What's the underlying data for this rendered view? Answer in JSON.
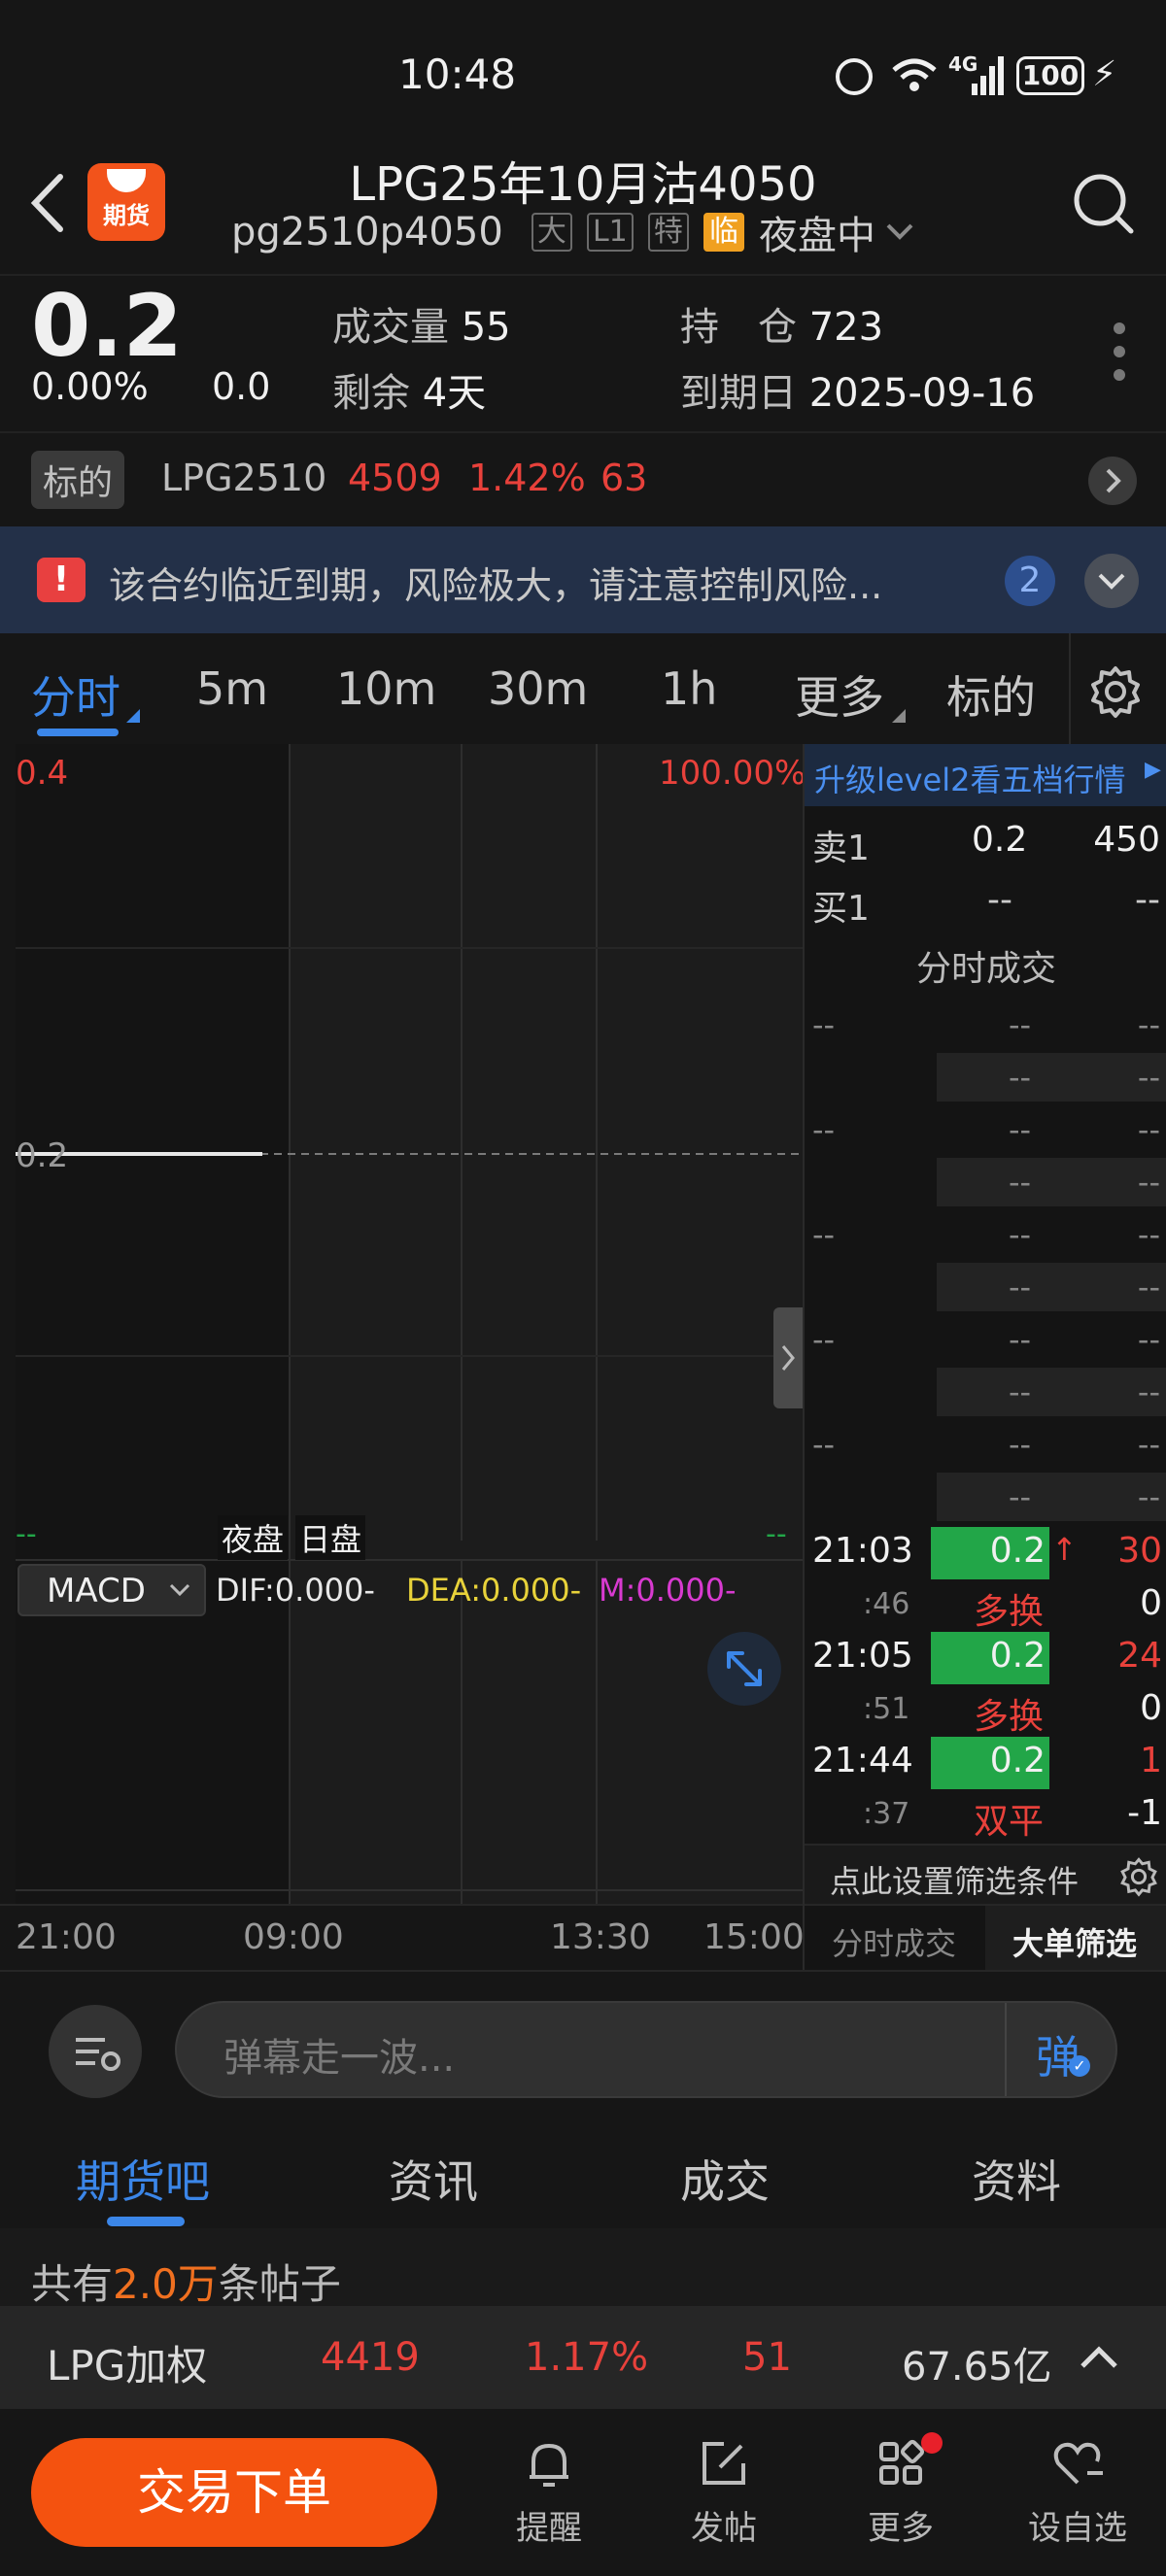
{
  "status_bar": {
    "time": "10:48",
    "network": "4G",
    "battery": "100"
  },
  "header": {
    "title": "LPG25年10月沽4050",
    "code": "pg2510p4050",
    "tags": [
      "大",
      "L1",
      "特"
    ],
    "tag_highlight": "临",
    "session": "夜盘中",
    "logo_text": "期货"
  },
  "quote": {
    "price": "0.2",
    "change_pct": "0.00%",
    "change": "0.0",
    "volume_label": "成交量",
    "volume": "55",
    "remaining_label": "剩余",
    "remaining": "4天",
    "oi_label": "持　仓",
    "oi": "723",
    "expiry_label": "到期日",
    "expiry": "2025-09-16"
  },
  "underlying": {
    "label": "标的",
    "code": "LPG2510",
    "price": "4509",
    "pct": "1.42%",
    "change": "63"
  },
  "warning": {
    "text": "该合约临近到期，风险极大，请注意控制风险...",
    "count": "2"
  },
  "periods": {
    "tabs": [
      "分时",
      "5m",
      "10m",
      "30m",
      "1h",
      "更多",
      "标的"
    ],
    "active": 0
  },
  "chart": {
    "y_top": "0.4",
    "y_top_pct": "100.00%",
    "y_mid": "0.2",
    "y_bottom_left": "--",
    "y_bottom_right": "--",
    "session_labels": [
      "夜盘",
      "日盘"
    ],
    "indicator": "MACD",
    "dif": "DIF:0.000-",
    "dea": "DEA:0.000-",
    "m": "M:0.000-",
    "x_labels": [
      "21:00",
      "09:00",
      "13:30",
      "15:00"
    ],
    "colors": {
      "price_line": "#e8e8e8",
      "dif": "#e8e8e8",
      "dea": "#e8d23a",
      "m": "#d83ad0"
    }
  },
  "orderbook": {
    "upgrade": "升级level2看五档行情",
    "sell_label": "卖1",
    "sell_price": "0.2",
    "sell_vol": "450",
    "buy_label": "买1",
    "buy_price": "--",
    "buy_vol": "--",
    "section_title": "分时成交"
  },
  "trades": [
    {
      "time": "21:03",
      "sec": ":46",
      "price": "0.2",
      "vol": "30",
      "type": "多换",
      "oi": "0",
      "arrow": "↑"
    },
    {
      "time": "21:05",
      "sec": ":51",
      "price": "0.2",
      "vol": "24",
      "type": "多换",
      "oi": "0",
      "arrow": ""
    },
    {
      "time": "21:44",
      "sec": ":37",
      "price": "0.2",
      "vol": "1",
      "type": "双平",
      "oi": "-1",
      "arrow": ""
    }
  ],
  "filter": {
    "text": "点此设置筛选条件",
    "tab1": "分时成交",
    "tab2": "大单筛选"
  },
  "danmu": {
    "placeholder": "弹幕走一波...",
    "send": "弹"
  },
  "bottom_tabs": {
    "items": [
      "期货吧",
      "资讯",
      "成交",
      "资料"
    ],
    "active": 0
  },
  "posts": {
    "prefix": "共有",
    "count": "2.0万",
    "suffix": "条帖子"
  },
  "ticker": {
    "name": "LPG加权",
    "price": "4419",
    "pct": "1.17%",
    "change": "51",
    "amount": "67.65亿"
  },
  "bottom_bar": {
    "trade": "交易下单",
    "remind": "提醒",
    "post": "发帖",
    "more": "更多",
    "watch": "设自选"
  }
}
